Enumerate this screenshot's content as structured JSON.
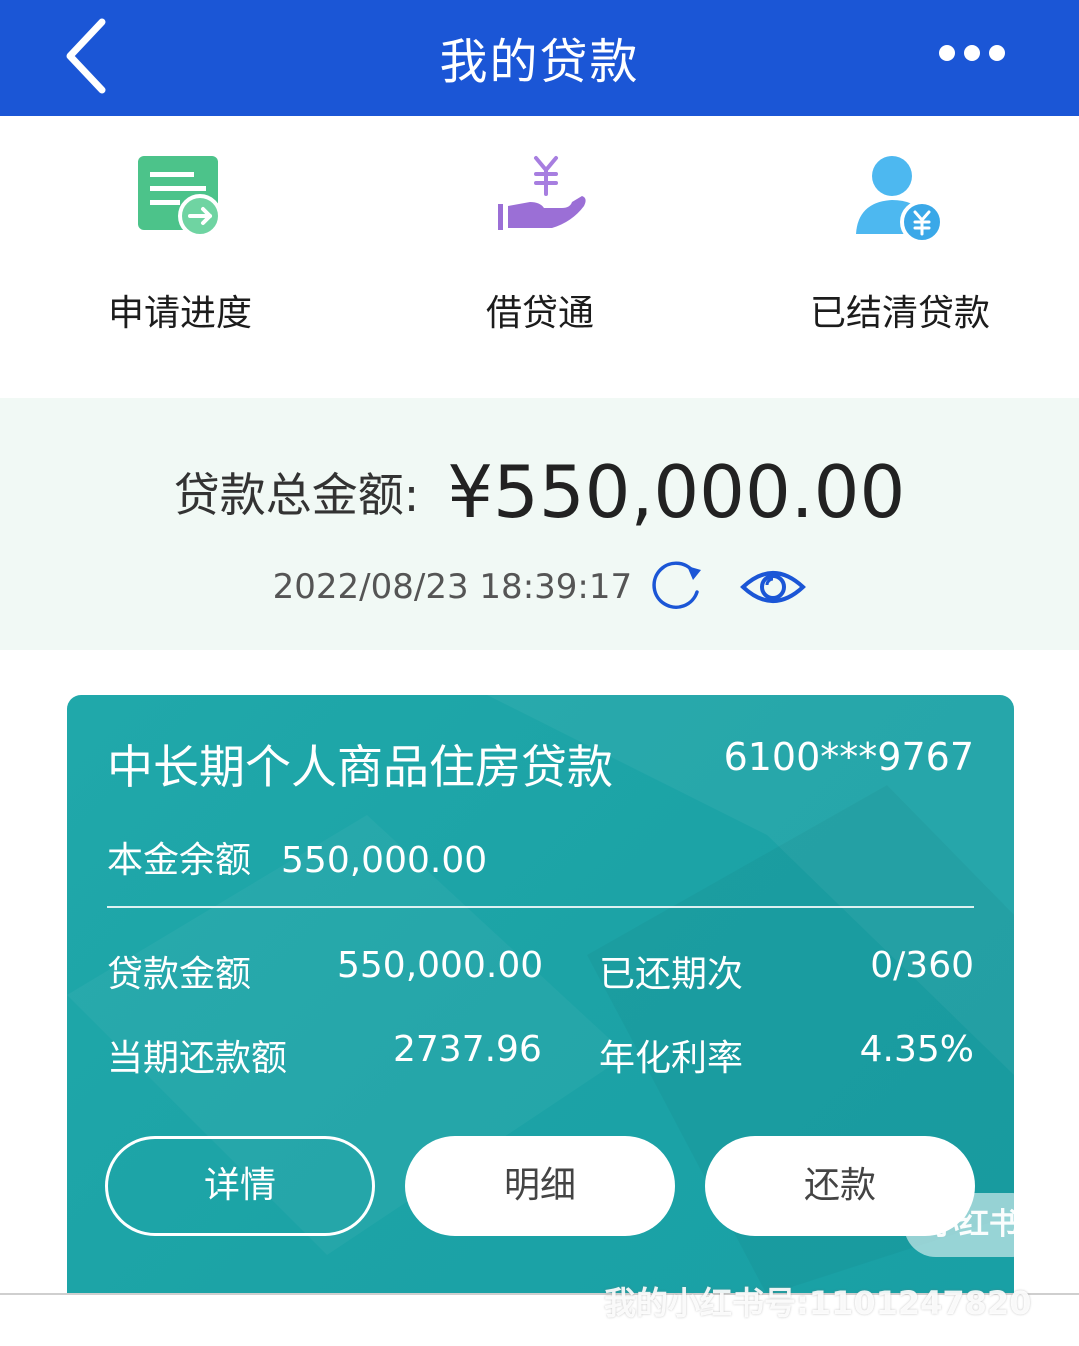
{
  "header": {
    "title": "我的贷款"
  },
  "quick_entries": [
    {
      "label": "申请进度",
      "icon": "document-arrow-icon"
    },
    {
      "label": "借贷通",
      "icon": "hand-yuan-icon"
    },
    {
      "label": "已结清贷款",
      "icon": "user-yuan-icon"
    }
  ],
  "total": {
    "label": "贷款总金额:",
    "amount": "¥550,000.00",
    "timestamp": "2022/08/23 18:39:17"
  },
  "loan": {
    "name": "中长期个人商品住房贷款",
    "account": "6100***9767",
    "principal_label": "本金余额",
    "principal_value": "550,000.00",
    "loan_amount_label": "贷款金额",
    "loan_amount_value": "550,000.00",
    "repaid_terms_label": "已还期次",
    "repaid_terms_value": "0/360",
    "current_payment_label": "当期还款额",
    "current_payment_value": "2737.96",
    "annual_rate_label": "年化利率",
    "annual_rate_value": "4.35%",
    "buttons": {
      "details": "详情",
      "statement": "明细",
      "repay": "还款"
    }
  },
  "watermark": {
    "badge": "小红书",
    "account": "我的小红书号:1101247820"
  },
  "colors": {
    "header_bg": "#1b56d6",
    "total_bg": "#f1f9f5",
    "card_bg": "#1ca3a6",
    "icon_green": "#4cc38a",
    "icon_purple": "#9b6fd6",
    "icon_blue": "#4db8f0"
  }
}
